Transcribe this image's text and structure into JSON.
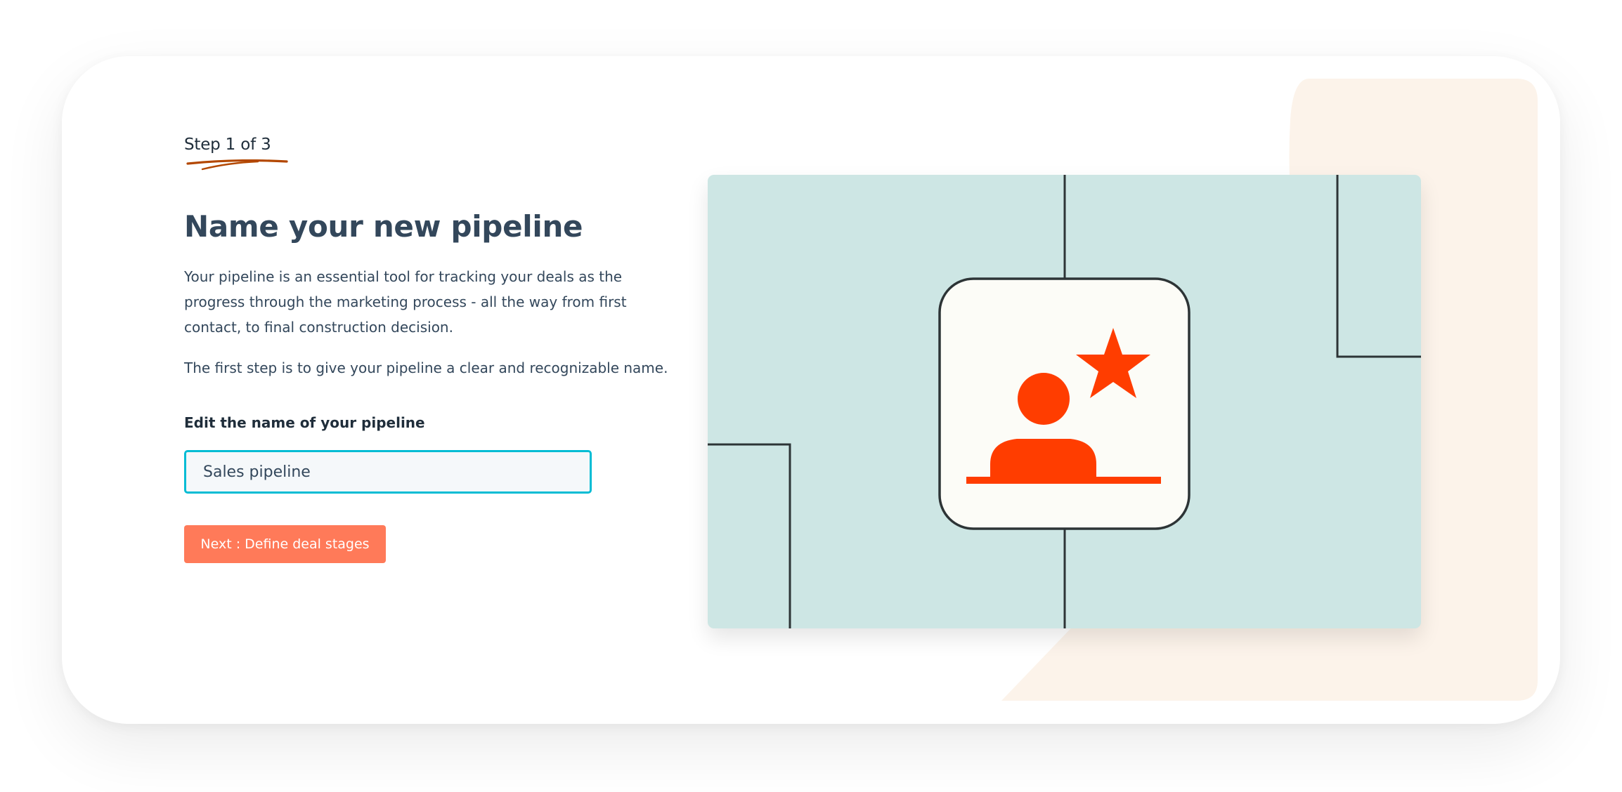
{
  "step": {
    "label": "Step 1 of 3"
  },
  "main": {
    "title": "Name your new pipeline",
    "description": "Your pipeline is an essential tool for tracking your deals as the progress through the marketing process - all the way from first contact, to final construction decision.",
    "description2": "The first step is to give your pipeline a clear and recognizable name."
  },
  "form": {
    "label": "Edit the name of your pipeline",
    "value": "Sales pipeline"
  },
  "actions": {
    "next_label": "Next : Define deal stages"
  },
  "illustration": {
    "icon": "user-star-icon",
    "background_color": "#cde6e4",
    "accent_color": "#ff3d00"
  },
  "colors": {
    "heading": "#33475b",
    "primary_button": "#ff7a59",
    "input_focus": "#00bcd4",
    "step_underline": "#b34700",
    "decor_blob": "#fcf3ea"
  }
}
